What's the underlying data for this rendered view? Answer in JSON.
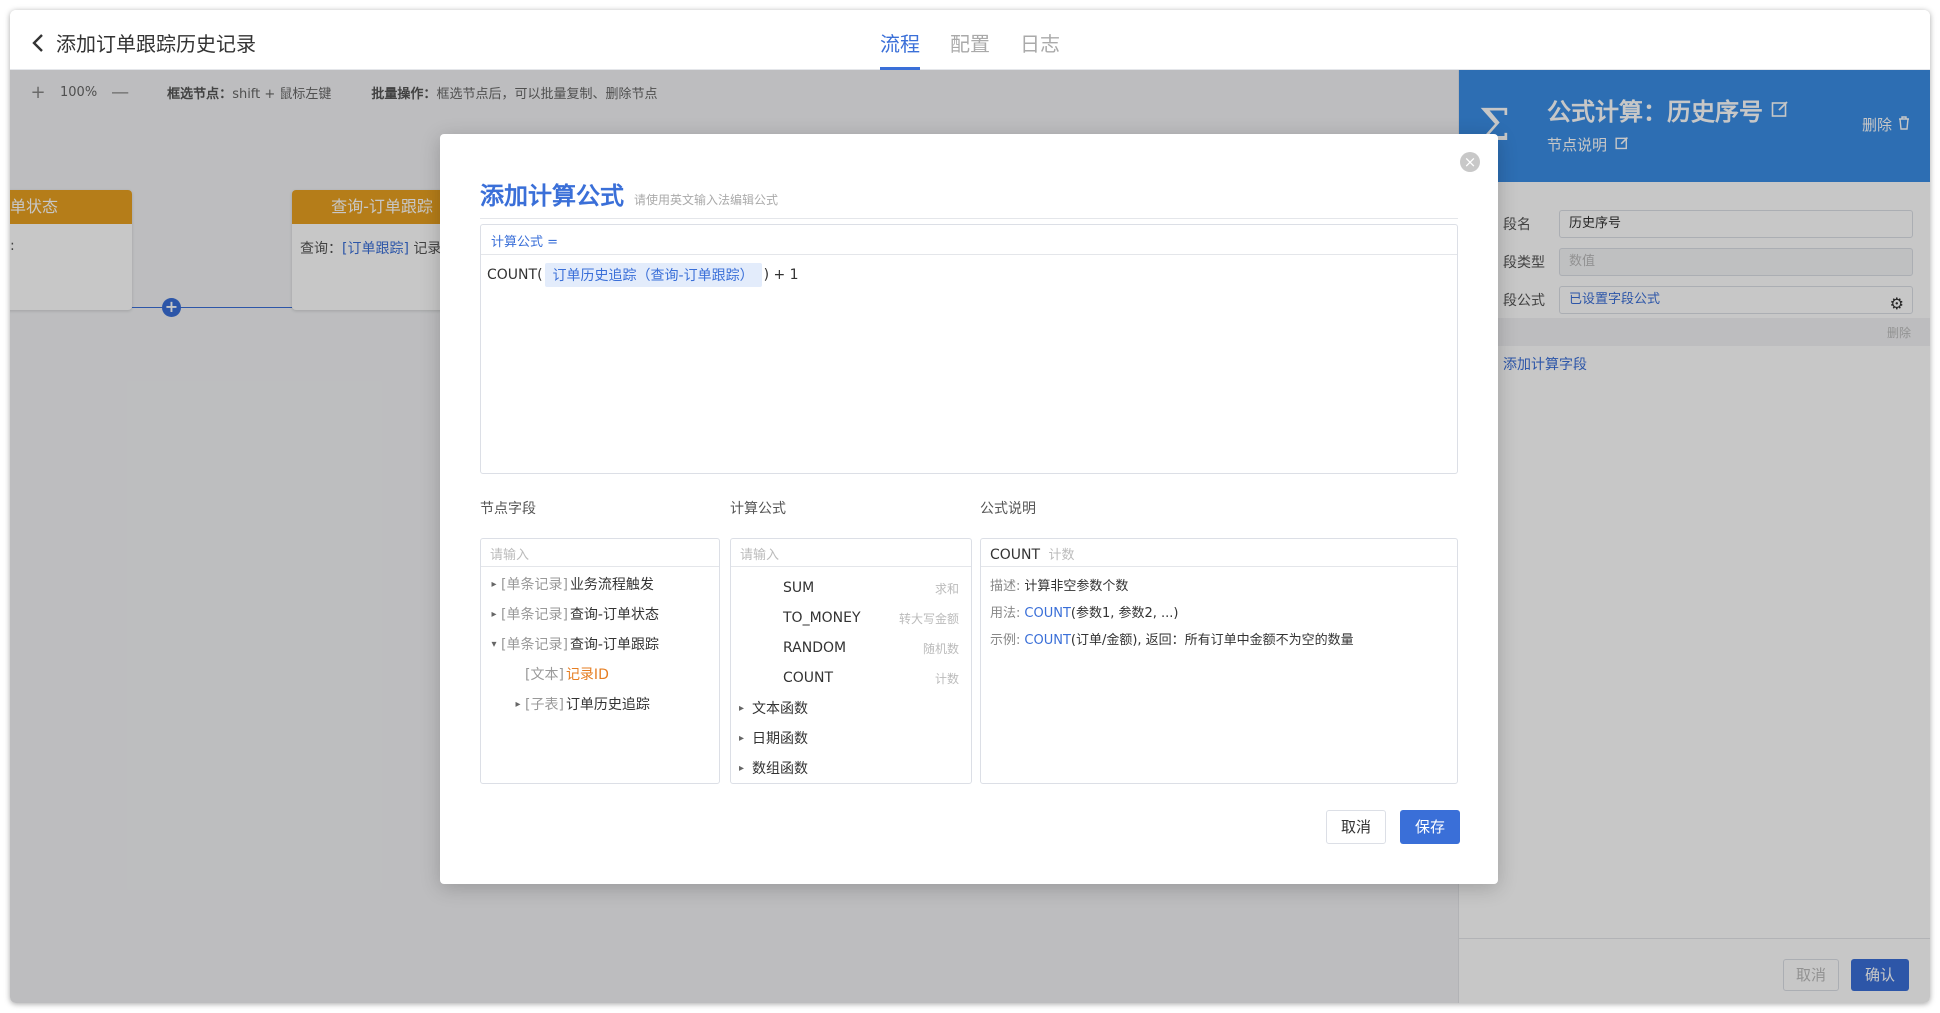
{
  "header": {
    "title": "添加订单跟踪历史记录",
    "tabs": [
      {
        "label": "流程",
        "active": true
      },
      {
        "label": "配置",
        "active": false
      },
      {
        "label": "日志",
        "active": false
      }
    ]
  },
  "toolbar": {
    "zoom_in": "+",
    "zoom_level": "100%",
    "zoom_out": "—",
    "select_hint_label": "框选节点：",
    "select_hint_value": "shift + 鼠标左键",
    "batch_hint_label": "批量操作：",
    "batch_hint_value": "框选节点后，可以批量复制、删除节点"
  },
  "canvas": {
    "node1": {
      "head": "单状态",
      "body": ":"
    },
    "node2": {
      "head": "查询-订单跟踪",
      "body_prefix": "查询：",
      "body_link": "[订单跟踪]",
      "body_suffix": " 记录"
    },
    "add_button": "+"
  },
  "right_panel": {
    "title": "公式计算：历史序号",
    "subtitle": "节点说明",
    "delete_label": "删除",
    "rows": [
      {
        "label": "段名",
        "value": "历史序号"
      },
      {
        "label": "段类型",
        "value": "数值"
      },
      {
        "label": "段公式",
        "value": "已设置字段公式"
      }
    ],
    "row_delete": "删除",
    "add_field": "添加计算字段",
    "cancel": "取消",
    "confirm": "确认",
    "accent": "#3a8ee6"
  },
  "modal": {
    "title": "添加计算公式",
    "subtitle": "请使用英文输入法编辑公式",
    "editor_label": "计算公式 =",
    "formula_prefix": "COUNT(",
    "formula_tag": "订单历史追踪（查询-订单跟踪）",
    "formula_suffix": ") + 1",
    "fields_label": "节点字段",
    "functions_label": "计算公式",
    "doc_label": "公式说明",
    "search_placeholder": "请输入",
    "field_tree": [
      {
        "type": "[单条记录]",
        "name": "业务流程触发"
      },
      {
        "type": "[单条记录]",
        "name": "查询-订单状态"
      },
      {
        "type": "[单条记录]",
        "name": "查询-订单跟踪"
      },
      {
        "type": "[文本]",
        "name": "记录ID"
      },
      {
        "type": "[子表]",
        "name": "订单历史追踪"
      }
    ],
    "functions": [
      {
        "name": "SUM",
        "desc": "求和"
      },
      {
        "name": "TO_MONEY",
        "desc": "转大写金额"
      },
      {
        "name": "RANDOM",
        "desc": "随机数"
      },
      {
        "name": "COUNT",
        "desc": "计数"
      }
    ],
    "categories": [
      "文本函数",
      "日期函数",
      "数组函数"
    ],
    "doc": {
      "name": "COUNT",
      "name_sub": "计数",
      "desc_key": "描述:",
      "desc": "计算非空参数个数",
      "usage_key": "用法:",
      "usage_fn": "COUNT",
      "usage_args": "(参数1, 参数2, ...)",
      "example_key": "示例:",
      "example_fn": "COUNT",
      "example_args": "(订单/金额), 返回：所有订单中金额不为空的数量"
    },
    "cancel": "取消",
    "save": "保存",
    "close": "×"
  }
}
